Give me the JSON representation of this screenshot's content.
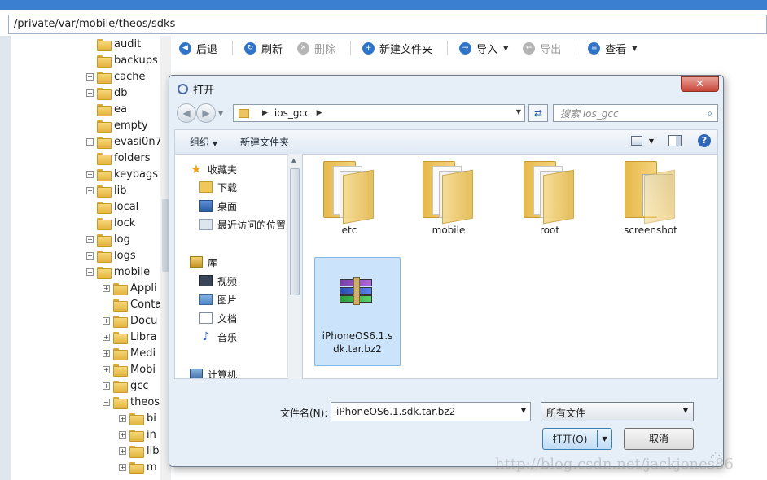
{
  "path_bar": "/private/var/mobile/theos/sdks",
  "tree": {
    "items": [
      {
        "label": "audit",
        "depth": 0,
        "expander": ""
      },
      {
        "label": "backups",
        "depth": 0,
        "expander": ""
      },
      {
        "label": "cache",
        "depth": 0,
        "expander": "+"
      },
      {
        "label": "db",
        "depth": 0,
        "expander": "+"
      },
      {
        "label": "ea",
        "depth": 0,
        "expander": ""
      },
      {
        "label": "empty",
        "depth": 0,
        "expander": ""
      },
      {
        "label": "evasi0n7",
        "depth": 0,
        "expander": "+"
      },
      {
        "label": "folders",
        "depth": 0,
        "expander": ""
      },
      {
        "label": "keybags",
        "depth": 0,
        "expander": "+"
      },
      {
        "label": "lib",
        "depth": 0,
        "expander": "+"
      },
      {
        "label": "local",
        "depth": 0,
        "expander": ""
      },
      {
        "label": "lock",
        "depth": 0,
        "expander": ""
      },
      {
        "label": "log",
        "depth": 0,
        "expander": "+"
      },
      {
        "label": "logs",
        "depth": 0,
        "expander": "+"
      },
      {
        "label": "mobile",
        "depth": 0,
        "expander": "−"
      },
      {
        "label": "Appli",
        "depth": 1,
        "expander": "+"
      },
      {
        "label": "Conta",
        "depth": 1,
        "expander": ""
      },
      {
        "label": "Docu",
        "depth": 1,
        "expander": "+"
      },
      {
        "label": "Libra",
        "depth": 1,
        "expander": "+"
      },
      {
        "label": "Medi",
        "depth": 1,
        "expander": "+"
      },
      {
        "label": "Mobi",
        "depth": 1,
        "expander": "+"
      },
      {
        "label": "gcc",
        "depth": 1,
        "expander": "+"
      },
      {
        "label": "theos",
        "depth": 1,
        "expander": "−"
      },
      {
        "label": "bi",
        "depth": 2,
        "expander": "+"
      },
      {
        "label": "in",
        "depth": 2,
        "expander": "+"
      },
      {
        "label": "lib",
        "depth": 2,
        "expander": "+"
      },
      {
        "label": "m",
        "depth": 2,
        "expander": "+"
      }
    ]
  },
  "toolbar": {
    "back": "后退",
    "refresh": "刷新",
    "delete": "删除",
    "new_folder": "新建文件夹",
    "import": "导入",
    "export": "导出",
    "view": "查看"
  },
  "dialog": {
    "title": "打开",
    "close_glyph": "✕",
    "address_folder": "ios_gcc",
    "search_placeholder": "搜索 ios_gcc",
    "cmd_organize": "组织",
    "cmd_new_folder": "新建文件夹",
    "nav": {
      "favorites": "收藏夹",
      "downloads": "下载",
      "desktop": "桌面",
      "recent": "最近访问的位置",
      "libraries": "库",
      "videos": "视频",
      "pictures": "图片",
      "documents": "文档",
      "music": "音乐",
      "computer": "计算机"
    },
    "files": [
      {
        "name": "etc"
      },
      {
        "name": "mobile"
      },
      {
        "name": "root"
      },
      {
        "name": "screenshot"
      }
    ],
    "selected_file": "iPhoneOS6.1.sdk.tar.bz2",
    "filename_label": "文件名(N):",
    "filename_value": "iPhoneOS6.1.sdk.tar.bz2",
    "filetype_value": "所有文件",
    "open_button": "打开(O)",
    "cancel_button": "取消"
  },
  "watermark": "http://blog.csdn.net/jackjones86"
}
